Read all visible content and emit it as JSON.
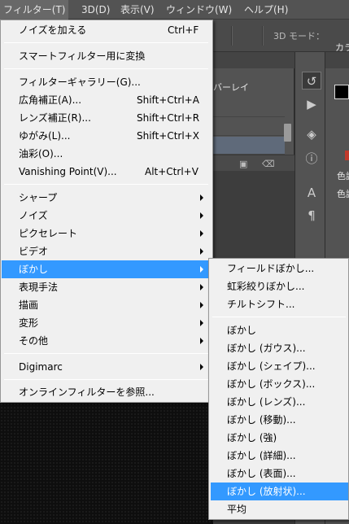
{
  "menubar": {
    "items": [
      {
        "label": "フィルター(T)"
      },
      {
        "label": "3D(D)"
      },
      {
        "label": "表示(V)"
      },
      {
        "label": "ウィンドウ(W)"
      },
      {
        "label": "ヘルプ(H)"
      }
    ]
  },
  "options_bar": {
    "mode_label": "3D モード："
  },
  "layers_panel": {
    "blend_mode": "バーレイ"
  },
  "right_panel": {
    "tab_label": "カラ",
    "text_1": "色調",
    "text_2": "色調"
  },
  "filter_menu": {
    "items": [
      {
        "label": "ノイズを加える",
        "shortcut": "Ctrl+F"
      },
      {
        "label": "スマートフィルター用に変換"
      },
      {
        "label": "フィルターギャラリー(G)..."
      },
      {
        "label": "広角補正(A)...",
        "shortcut": "Shift+Ctrl+A"
      },
      {
        "label": "レンズ補正(R)...",
        "shortcut": "Shift+Ctrl+R"
      },
      {
        "label": "ゆがみ(L)...",
        "shortcut": "Shift+Ctrl+X"
      },
      {
        "label": "油彩(O)..."
      },
      {
        "label": "Vanishing Point(V)...",
        "shortcut": "Alt+Ctrl+V"
      },
      {
        "label": "シャープ"
      },
      {
        "label": "ノイズ"
      },
      {
        "label": "ピクセレート"
      },
      {
        "label": "ビデオ"
      },
      {
        "label": "ぼかし"
      },
      {
        "label": "表現手法"
      },
      {
        "label": "描画"
      },
      {
        "label": "変形"
      },
      {
        "label": "その他"
      },
      {
        "label": "Digimarc"
      },
      {
        "label": "オンラインフィルターを参照..."
      }
    ]
  },
  "blur_submenu": {
    "items": [
      {
        "label": "フィールドぼかし..."
      },
      {
        "label": "虹彩絞りぼかし..."
      },
      {
        "label": "チルトシフト..."
      },
      {
        "label": "ぼかし"
      },
      {
        "label": "ぼかし (ガウス)..."
      },
      {
        "label": "ぼかし (シェイプ)..."
      },
      {
        "label": "ぼかし (ボックス)..."
      },
      {
        "label": "ぼかし (レンズ)..."
      },
      {
        "label": "ぼかし (移動)..."
      },
      {
        "label": "ぼかし (強)"
      },
      {
        "label": "ぼかし (詳細)..."
      },
      {
        "label": "ぼかし (表面)..."
      },
      {
        "label": "ぼかし (放射状)..."
      },
      {
        "label": "平均"
      }
    ]
  },
  "colors": {
    "menu_bg": "#f0f0f0",
    "highlight": "#3399ff",
    "app_bg": "#535353"
  }
}
